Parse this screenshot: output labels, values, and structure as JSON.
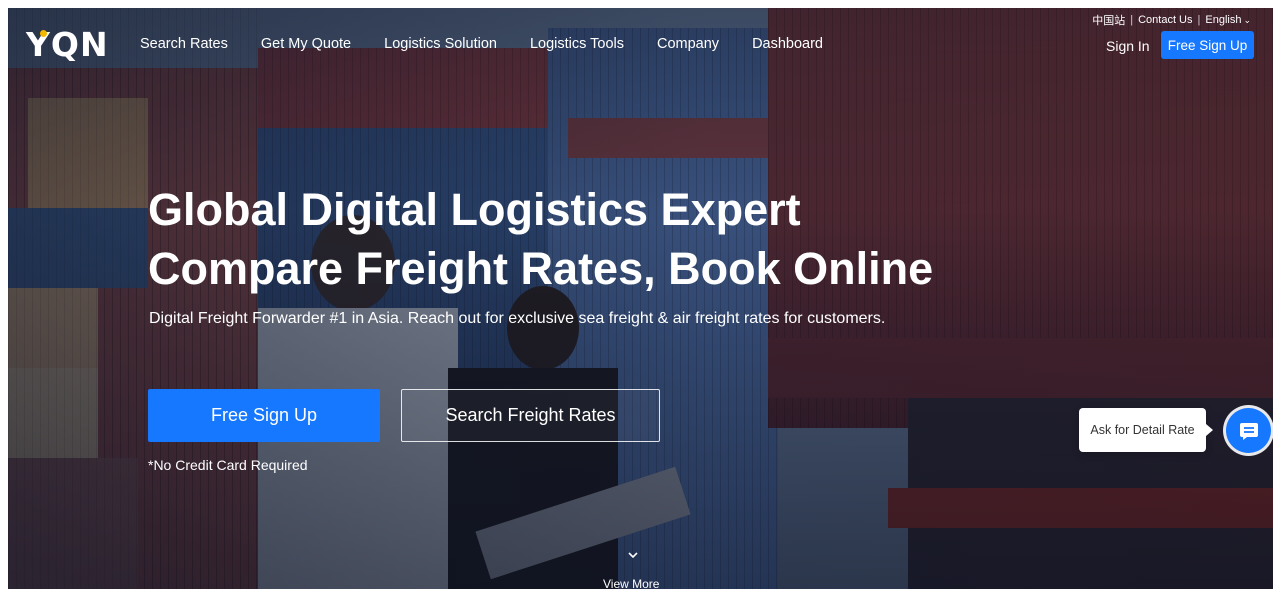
{
  "utility_bar": {
    "china_site": "中国站",
    "separator": "|",
    "contact": "Contact Us",
    "language": "English"
  },
  "brand": {
    "logo_text": "YQN",
    "accent_color": "#f5b800"
  },
  "nav": {
    "items": [
      {
        "label": "Search Rates"
      },
      {
        "label": "Get My Quote"
      },
      {
        "label": "Logistics Solution"
      },
      {
        "label": "Logistics Tools"
      },
      {
        "label": "Company"
      },
      {
        "label": "Dashboard"
      }
    ],
    "sign_in": "Sign In",
    "free_sign_up": "Free Sign Up"
  },
  "hero": {
    "title_line1": "Global Digital Logistics Expert",
    "title_line2": "Compare Freight Rates, Book Online",
    "subtitle": "Digital Freight Forwarder #1 in Asia. Reach out for exclusive sea freight & air freight rates for customers.",
    "primary_cta": "Free Sign Up",
    "secondary_cta": "Search Freight Rates",
    "note": "*No Credit Card Required",
    "view_more": "View More"
  },
  "chat_widget": {
    "bubble_text": "Ask for Detail Rate",
    "icon": "chat-icon"
  },
  "colors": {
    "primary": "#1677ff",
    "text_on_dark": "#ffffff"
  }
}
